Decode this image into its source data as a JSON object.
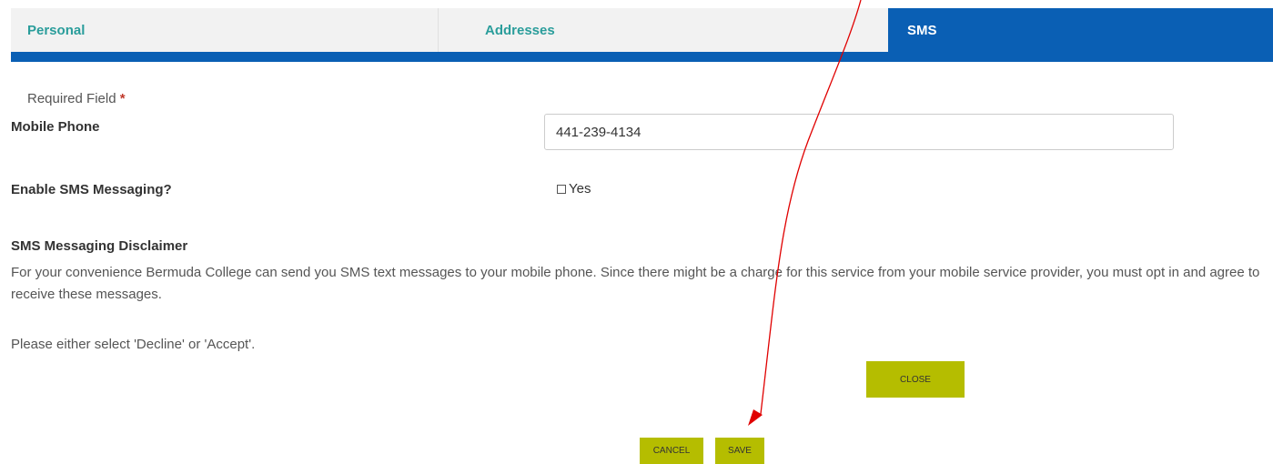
{
  "tabs": {
    "personal": "Personal",
    "addresses": "Addresses",
    "sms": "SMS"
  },
  "form": {
    "required_text": "Required Field",
    "required_marker": "*",
    "mobile_label": "Mobile Phone",
    "mobile_value": "441-239-4134",
    "enable_label": "Enable SMS Messaging?",
    "enable_option": "Yes",
    "enable_checked": false
  },
  "disclaimer": {
    "title": "SMS Messaging Disclaimer",
    "body": "For your convenience Bermuda College can send you SMS text messages to your mobile phone. Since there might be a charge for this service from your mobile service provider, you must opt in and agree to receive these messages.",
    "instruction": "Please either select 'Decline' or 'Accept'."
  },
  "buttons": {
    "close": "CLOSE",
    "cancel": "CANCEL",
    "save": "SAVE"
  },
  "colors": {
    "accent": "#0a5fb4",
    "tab_text": "#2a9d9b",
    "button": "#b5bd00",
    "annotation": "#e00000"
  }
}
